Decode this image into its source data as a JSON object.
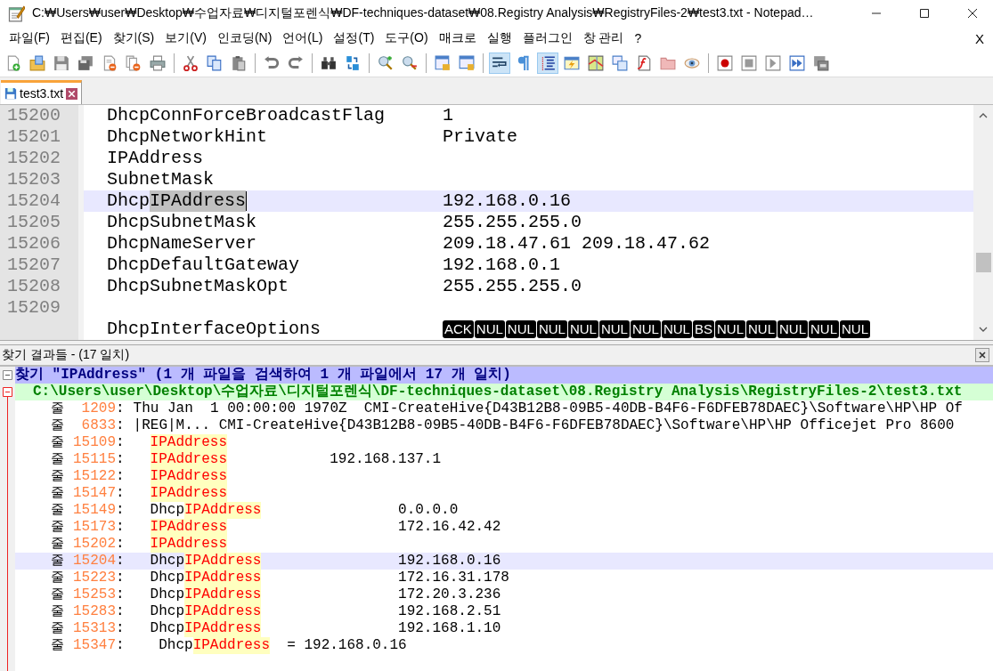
{
  "window": {
    "title": "C:₩Users₩user₩Desktop₩수업자료₩디지털포렌식₩DF-techniques-dataset₩08.Registry Analysis₩RegistryFiles-2₩test3.txt - Notepad…"
  },
  "menu": [
    "파일(F)",
    "편집(E)",
    "찾기(S)",
    "보기(V)",
    "인코딩(N)",
    "언어(L)",
    "설정(T)",
    "도구(O)",
    "매크로",
    "실행",
    "플러그인",
    "창 관리",
    "?"
  ],
  "menu_close": "X",
  "toolbar": [
    {
      "kind": "new",
      "on": false
    },
    {
      "kind": "open",
      "on": false
    },
    {
      "kind": "save",
      "on": false
    },
    {
      "kind": "save-all",
      "on": false
    },
    {
      "kind": "close",
      "on": false
    },
    {
      "kind": "close-all",
      "on": false
    },
    {
      "kind": "print",
      "on": false
    },
    {
      "kind": "separator"
    },
    {
      "kind": "cut",
      "on": false
    },
    {
      "kind": "copy",
      "on": false
    },
    {
      "kind": "paste",
      "on": false
    },
    {
      "kind": "separator"
    },
    {
      "kind": "undo",
      "on": false
    },
    {
      "kind": "redo",
      "on": false
    },
    {
      "kind": "separator"
    },
    {
      "kind": "find",
      "on": false
    },
    {
      "kind": "replace",
      "on": false
    },
    {
      "kind": "separator"
    },
    {
      "kind": "zoom-in",
      "on": false
    },
    {
      "kind": "zoom-out",
      "on": false
    },
    {
      "kind": "separator"
    },
    {
      "kind": "sync-v",
      "on": false
    },
    {
      "kind": "sync-h",
      "on": false
    },
    {
      "kind": "separator"
    },
    {
      "kind": "wrap",
      "on": true
    },
    {
      "kind": "pilcrow",
      "on": false
    },
    {
      "kind": "indent",
      "on": true
    },
    {
      "kind": "udl",
      "on": false
    },
    {
      "kind": "map",
      "on": false
    },
    {
      "kind": "doclist",
      "on": false
    },
    {
      "kind": "function",
      "on": false
    },
    {
      "kind": "folder",
      "on": false
    },
    {
      "kind": "monitor",
      "on": false
    },
    {
      "kind": "separator"
    },
    {
      "kind": "record",
      "on": false
    },
    {
      "kind": "stop",
      "on": false
    },
    {
      "kind": "play",
      "on": false
    },
    {
      "kind": "run-multi",
      "on": false
    },
    {
      "kind": "save-macro",
      "on": false
    }
  ],
  "tabs": [
    {
      "label": "test3.txt",
      "selected": true
    }
  ],
  "editor": {
    "lines": [
      {
        "number": "15200",
        "key": "DhcpConnForceBroadcastFlag",
        "value": "1",
        "current": false
      },
      {
        "number": "15201",
        "key": "DhcpNetworkHint",
        "value": "Private",
        "current": false
      },
      {
        "number": "15202",
        "key": "IPAddress",
        "current": false
      },
      {
        "number": "15203",
        "key": "SubnetMask",
        "current": false
      },
      {
        "number": "15204",
        "key": "Dhcp",
        "selection": "IPAddress",
        "value": "192.168.0.16",
        "current": true
      },
      {
        "number": "15205",
        "key": "DhcpSubnetMask",
        "value": "255.255.255.0",
        "current": false
      },
      {
        "number": "15206",
        "key": "DhcpNameServer",
        "value": "209.18.47.61 209.18.47.62",
        "current": false
      },
      {
        "number": "15207",
        "key": "DhcpDefaultGateway",
        "value": "192.168.0.1",
        "current": false
      },
      {
        "number": "15208",
        "key": "DhcpSubnetMaskOpt",
        "value": "255.255.255.0",
        "current": false
      },
      {
        "number": "15209",
        "current": false
      },
      {
        "key": "DhcpInterfaceOptions",
        "control_chars": [
          "ACK",
          "NUL",
          "NUL",
          "NUL",
          "NUL",
          "NUL",
          "NUL",
          "NUL",
          "BS",
          "NUL",
          "NUL",
          "NUL",
          "NUL",
          "NUL"
        ],
        "current": false
      }
    ]
  },
  "find_results": {
    "title": "찾기 결과들 - (17 일치)",
    "search_line": "찾기 \"IPAddress\" (1 개 파일을 검색하여 1 개 파일에서 17 개 일치)",
    "file_line": "C:\\Users\\user\\Desktop\\수업자료\\디지털포렌식\\DF-techniques-dataset\\08.Registry Analysis\\RegistryFiles-2\\test3.txt",
    "hits": [
      {
        "kind": "plain",
        "label": "줄",
        "separator": ":",
        "line": "1209",
        "selected": false,
        "parts": [
          {
            "text": "Thu Jan  1 00:00:00 1970Z  CMI-CreateHive{D43B12B8-09B5-40DB-B4F6-F6DFEB78DAEC}\\Software\\HP\\HP Of",
            "hit": false
          }
        ]
      },
      {
        "kind": "plain",
        "label": "줄",
        "separator": ":",
        "line": "6833",
        "selected": false,
        "parts": [
          {
            "text": "|REG|M... CMI-CreateHive{D43B12B8-09B5-40DB-B4F6-F6DFEB78DAEC}\\Software\\HP\\HP Officejet Pro 8600",
            "hit": false
          }
        ]
      },
      {
        "kind": "tabbed",
        "label": "줄",
        "separator": ":",
        "line": "15109",
        "selected": false,
        "parts": [
          {
            "text": "IPAddress",
            "hit": true
          }
        ]
      },
      {
        "kind": "tabbed",
        "label": "줄",
        "separator": ":",
        "line": "15115",
        "selected": false,
        "parts": [
          {
            "text": "IPAddress",
            "hit": true
          },
          {
            "text": "            192.168.137.1",
            "hit": false
          }
        ]
      },
      {
        "kind": "tabbed",
        "label": "줄",
        "separator": ":",
        "line": "15122",
        "selected": false,
        "parts": [
          {
            "text": "IPAddress",
            "hit": true
          }
        ]
      },
      {
        "kind": "tabbed",
        "label": "줄",
        "separator": ":",
        "line": "15147",
        "selected": false,
        "parts": [
          {
            "text": "IPAddress",
            "hit": true
          }
        ]
      },
      {
        "kind": "tabbed",
        "label": "줄",
        "separator": ":",
        "line": "15149",
        "selected": false,
        "parts": [
          {
            "text": "Dhcp",
            "hit": false
          },
          {
            "text": "IPAddress",
            "hit": true
          },
          {
            "text": "                0.0.0.0",
            "hit": false
          }
        ]
      },
      {
        "kind": "tabbed",
        "label": "줄",
        "separator": ":",
        "line": "15173",
        "selected": false,
        "parts": [
          {
            "text": "IPAddress",
            "hit": true
          },
          {
            "text": "                    172.16.42.42",
            "hit": false
          }
        ]
      },
      {
        "kind": "tabbed",
        "label": "줄",
        "separator": ":",
        "line": "15202",
        "selected": false,
        "parts": [
          {
            "text": "IPAddress",
            "hit": true
          }
        ]
      },
      {
        "kind": "tabbed",
        "label": "줄",
        "separator": ":",
        "line": "15204",
        "selected": true,
        "parts": [
          {
            "text": "Dhcp",
            "hit": false
          },
          {
            "text": "IPAddress",
            "hit": true
          },
          {
            "text": "                192.168.0.16",
            "hit": false
          }
        ]
      },
      {
        "kind": "tabbed",
        "label": "줄",
        "separator": ":",
        "line": "15223",
        "selected": false,
        "parts": [
          {
            "text": "Dhcp",
            "hit": false
          },
          {
            "text": "IPAddress",
            "hit": true
          },
          {
            "text": "                172.16.31.178",
            "hit": false
          }
        ]
      },
      {
        "kind": "tabbed",
        "label": "줄",
        "separator": ":",
        "line": "15253",
        "selected": false,
        "parts": [
          {
            "text": "Dhcp",
            "hit": false
          },
          {
            "text": "IPAddress",
            "hit": true
          },
          {
            "text": "                172.20.3.236",
            "hit": false
          }
        ]
      },
      {
        "kind": "tabbed",
        "label": "줄",
        "separator": ":",
        "line": "15283",
        "selected": false,
        "parts": [
          {
            "text": "Dhcp",
            "hit": false
          },
          {
            "text": "IPAddress",
            "hit": true
          },
          {
            "text": "                192.168.2.51",
            "hit": false
          }
        ]
      },
      {
        "kind": "tabbed",
        "label": "줄",
        "separator": ":",
        "line": "15313",
        "selected": false,
        "parts": [
          {
            "text": "Dhcp",
            "hit": false
          },
          {
            "text": "IPAddress",
            "hit": true
          },
          {
            "text": "                192.168.1.10",
            "hit": false
          }
        ]
      },
      {
        "kind": "tabbed",
        "label": "줄",
        "separator": ":",
        "line": "15347",
        "selected": false,
        "parts": [
          {
            "text": " Dhcp",
            "hit": false
          },
          {
            "text": "IPAddress",
            "hit": true
          },
          {
            "text": "  = 192.168.0.16",
            "hit": false
          }
        ]
      }
    ]
  }
}
